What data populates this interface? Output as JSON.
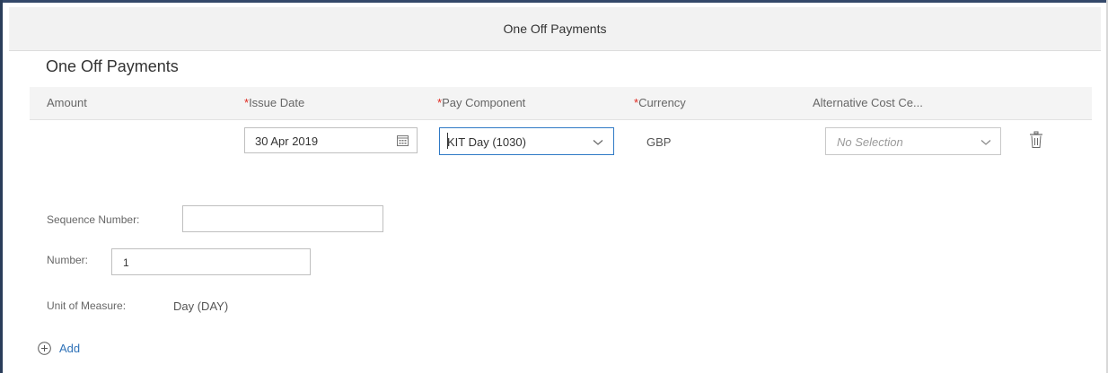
{
  "header": {
    "title": "One Off Payments"
  },
  "section": {
    "title": "One Off Payments"
  },
  "table": {
    "columns": [
      {
        "label": "Amount",
        "required": false
      },
      {
        "label": "Issue Date",
        "required": true
      },
      {
        "label": "Pay Component",
        "required": true
      },
      {
        "label": "Currency",
        "required": true
      },
      {
        "label": "Alternative Cost Ce...",
        "required": false
      }
    ],
    "required_marker": "*",
    "row": {
      "issue_date": "30 Apr 2019",
      "pay_component": "KIT Day (1030)",
      "currency": "GBP",
      "alternative_cost_center_placeholder": "No Selection"
    }
  },
  "details": {
    "sequence_number_label": "Sequence Number:",
    "sequence_number_value": "",
    "number_label": "Number:",
    "number_value": "1",
    "unit_label": "Unit of Measure:",
    "unit_value": "Day (DAY)"
  },
  "actions": {
    "add_label": "Add"
  },
  "colors": {
    "required": "#e0281e",
    "focus_border": "#2f79c5",
    "link": "#2f72b8",
    "header_bg": "#f2f2f2"
  },
  "icons": {
    "calendar": "calendar-icon",
    "dropdown": "chevron-down-icon",
    "delete": "trash-icon",
    "add": "add-circle-icon"
  }
}
